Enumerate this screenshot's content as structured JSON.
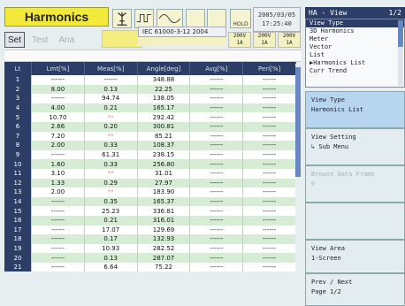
{
  "header": {
    "title": "Harmonics",
    "date": "2005/03/05",
    "time": "17:25:40",
    "hold_label": "HOLD",
    "standard": "IEC 61000-3-12 2004",
    "channels": [
      {
        "top": "200V",
        "bottom": "1A"
      },
      {
        "top": "200V",
        "bottom": "1A"
      },
      {
        "top": "200V",
        "bottom": "1A"
      }
    ]
  },
  "tabs": [
    {
      "label": "Set"
    },
    {
      "label": "Test"
    },
    {
      "label": "Ana"
    }
  ],
  "table": {
    "headers": [
      "Lt",
      "Lmt[%]",
      "Meas[%]",
      "Angle[deg]",
      "Avg[%]",
      "Peri[%]"
    ],
    "rows": [
      {
        "n": "1",
        "lmt": "------",
        "meas": "------",
        "angle": "348.88",
        "avg": "------",
        "peri": "------"
      },
      {
        "n": "2",
        "lmt": "8.00",
        "meas": "0.13",
        "angle": "22.25",
        "avg": "------",
        "peri": "------"
      },
      {
        "n": "3",
        "lmt": "------",
        "meas": "94.74",
        "angle": "138.05",
        "avg": "------",
        "peri": "------"
      },
      {
        "n": "4",
        "lmt": "4.00",
        "meas": "0.21",
        "angle": "165.17",
        "avg": "------",
        "peri": "------"
      },
      {
        "n": "5",
        "lmt": "10.70",
        "meas": "**",
        "angle": "292.42",
        "avg": "------",
        "peri": "------"
      },
      {
        "n": "6",
        "lmt": "2.66",
        "meas": "0.20",
        "angle": "300.81",
        "avg": "------",
        "peri": "------"
      },
      {
        "n": "7",
        "lmt": "7.20",
        "meas": "**",
        "angle": "85.21",
        "avg": "------",
        "peri": "------"
      },
      {
        "n": "8",
        "lmt": "2.00",
        "meas": "0.33",
        "angle": "108.37",
        "avg": "------",
        "peri": "------"
      },
      {
        "n": "9",
        "lmt": "------",
        "meas": "61.31",
        "angle": "238.15",
        "avg": "------",
        "peri": "------"
      },
      {
        "n": "10",
        "lmt": "1.60",
        "meas": "0.33",
        "angle": "256.80",
        "avg": "------",
        "peri": "------"
      },
      {
        "n": "11",
        "lmt": "3.10",
        "meas": "**",
        "angle": "31.01",
        "avg": "------",
        "peri": "------"
      },
      {
        "n": "12",
        "lmt": "1.33",
        "meas": "0.29",
        "angle": "27.97",
        "avg": "------",
        "peri": "------"
      },
      {
        "n": "13",
        "lmt": "2.00",
        "meas": "**",
        "angle": "183.90",
        "avg": "------",
        "peri": "------"
      },
      {
        "n": "14",
        "lmt": "------",
        "meas": "0.35",
        "angle": "165.37",
        "avg": "------",
        "peri": "------"
      },
      {
        "n": "15",
        "lmt": "------",
        "meas": "25.23",
        "angle": "336.81",
        "avg": "------",
        "peri": "------"
      },
      {
        "n": "16",
        "lmt": "------",
        "meas": "0.21",
        "angle": "316.01",
        "avg": "------",
        "peri": "------"
      },
      {
        "n": "17",
        "lmt": "------",
        "meas": "17.07",
        "angle": "129.69",
        "avg": "------",
        "peri": "------"
      },
      {
        "n": "18",
        "lmt": "------",
        "meas": "0.17",
        "angle": "132.93",
        "avg": "------",
        "peri": "------"
      },
      {
        "n": "19",
        "lmt": "------",
        "meas": "10.93",
        "angle": "282.52",
        "avg": "------",
        "peri": "------"
      },
      {
        "n": "20",
        "lmt": "------",
        "meas": "0.13",
        "angle": "287.07",
        "avg": "------",
        "peri": "------"
      },
      {
        "n": "21",
        "lmt": "------",
        "meas": "6.64",
        "angle": "75.22",
        "avg": "------",
        "peri": "------"
      }
    ]
  },
  "panel": {
    "header": "HA - View",
    "page": "1/2",
    "menu_items": [
      {
        "label": "View Type",
        "selected": true
      },
      {
        "label": "3D Harmonics",
        "selected": false
      },
      {
        "label": "Meter",
        "selected": false
      },
      {
        "label": "Vector",
        "selected": false
      },
      {
        "label": "List",
        "selected": false
      },
      {
        "label": "Harmonics List",
        "selected": false,
        "marker": "▶"
      },
      {
        "label": "Curr Trend",
        "selected": false
      }
    ],
    "softkeys": [
      {
        "line1": "View Type",
        "line2": "Harmonics List"
      },
      {
        "line1": "View Setting",
        "line2": "↳ Sub Menu"
      },
      {
        "line1": "Browse Data Frame",
        "line2": "0"
      },
      {
        "line1": "View Area",
        "line2": "1-Screen"
      },
      {
        "line1": "Prev / Next",
        "line2": "Page 1/2"
      }
    ]
  },
  "colors": {
    "title_bg": "#f2e93a",
    "table_header": "#2c3e66",
    "row_alt": "#d6ecd4",
    "warn": "#ee8a84"
  }
}
